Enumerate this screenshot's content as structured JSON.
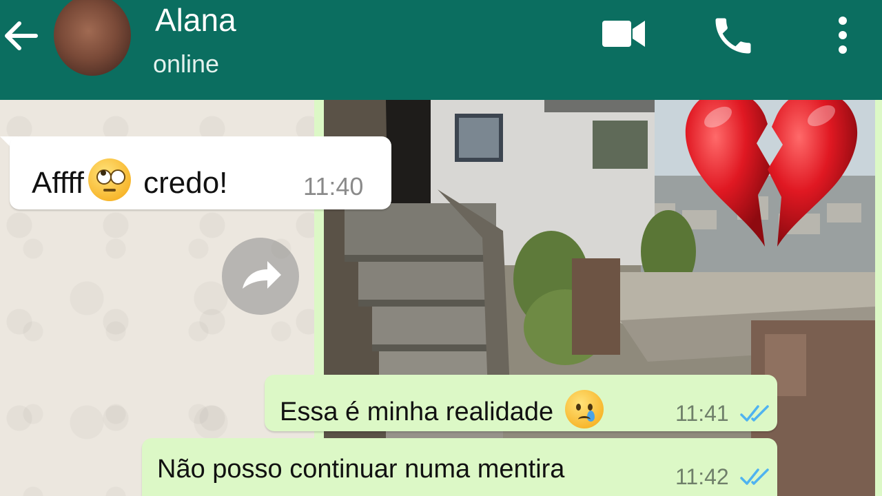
{
  "header": {
    "contact_name": "Alana",
    "status": "online",
    "background": "#0b6e60",
    "icons": [
      "back-arrow-icon",
      "avatar",
      "video-call-icon",
      "phone-icon",
      "more-vert-icon"
    ]
  },
  "messages": [
    {
      "direction": "incoming",
      "text_before": "Affff",
      "emoji": "face-with-rolling-eyes",
      "text_after": " credo!",
      "time": "11:40"
    },
    {
      "direction": "outgoing",
      "type": "image",
      "description_icon": "forward-icon"
    },
    {
      "direction": "outgoing",
      "text": "Essa é minha realidade ",
      "emoji": "crying-face",
      "time": "11:41",
      "status": "read"
    },
    {
      "direction": "outgoing",
      "text": "Não posso continuar numa mentira",
      "time": "11:42",
      "status": "read"
    }
  ],
  "colors": {
    "incoming_bubble": "#ffffff",
    "outgoing_bubble": "#dcf8c6",
    "read_ticks": "#4fb3f0"
  },
  "overlay": {
    "sticker": "broken-heart-icon"
  }
}
